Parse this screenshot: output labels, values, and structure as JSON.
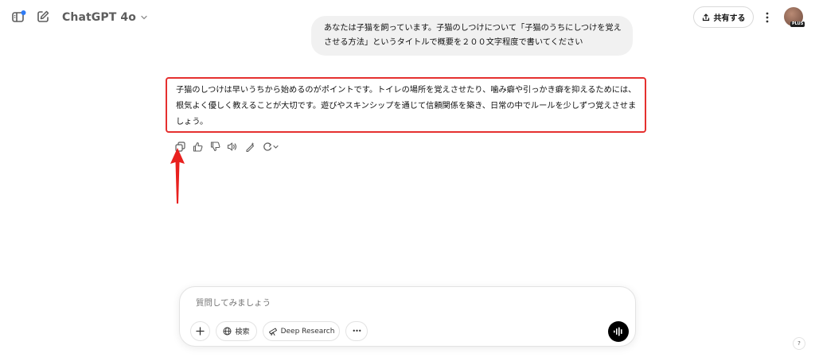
{
  "header": {
    "model_name": "ChatGPT 4o",
    "share_label": "共有する",
    "avatar_badge": "PLUS",
    "sidebar_icon": "sidebar-toggle-icon",
    "new_chat_icon": "new-chat-icon",
    "notification_color": "#2f7cf6"
  },
  "conversation": {
    "user_message": "あなたは子猫を飼っています。子猫のしつけについて「子猫のうちにしつけを覚えさせる方法」というタイトルで概要を２００文字程度で書いてください",
    "assistant_message": "子猫のしつけは早いうちから始めるのがポイントです。トイレの場所を覚えさせたり、噛み癖や引っかき癖を抑えるためには、根気よく優しく教えることが大切です。遊びやスキンシップを通じて信頼関係を築き、日常の中でルールを少しずつ覚えさせましょう。",
    "highlight_color": "#e5302f",
    "action_icons": [
      "copy-icon",
      "thumbs-up-icon",
      "thumbs-down-icon",
      "read-aloud-icon",
      "edit-canvas-icon",
      "regenerate-icon"
    ]
  },
  "composer": {
    "placeholder": "質問してみましょう",
    "search_label": "検索",
    "deep_research_label": "Deep Research",
    "more_label": "•••"
  },
  "help_label": "?"
}
